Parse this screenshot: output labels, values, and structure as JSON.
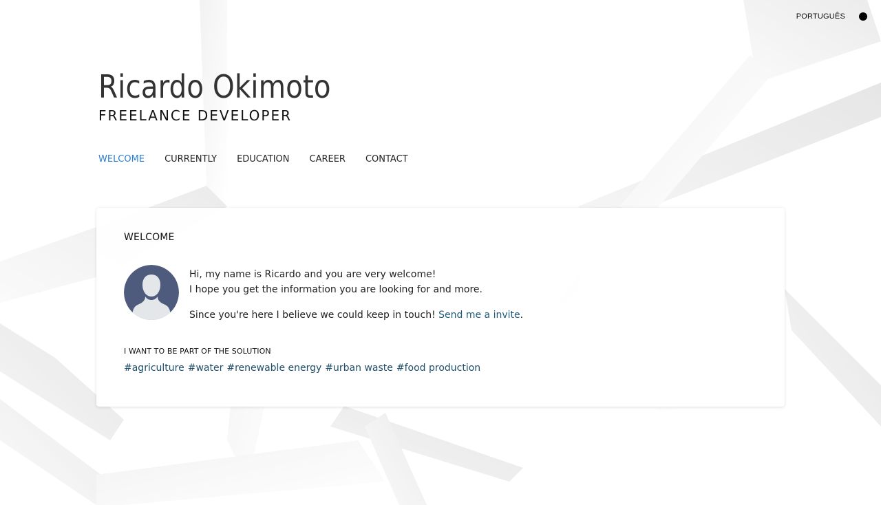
{
  "lang": {
    "label": "PORTUGUÊS"
  },
  "header": {
    "name": "Ricardo Okimoto",
    "role": "FREELANCE DEVELOPER"
  },
  "nav": {
    "items": [
      {
        "label": "WELCOME",
        "active": true
      },
      {
        "label": "CURRENTLY"
      },
      {
        "label": "EDUCATION"
      },
      {
        "label": "CAREER"
      },
      {
        "label": "CONTACT"
      }
    ]
  },
  "welcome": {
    "title": "WELCOME",
    "line1": "Hi, my name is Ricardo and you are very welcome!",
    "line2": "I hope you get the information you are looking for and more.",
    "line3_prefix": "Since you're here I believe we could keep in touch!",
    "invite_link": "Send me a invite",
    "line3_suffix": ".",
    "solution_title": "I WANT TO BE PART OF THE SOLUTION",
    "tags": [
      "#agriculture",
      "#water",
      "#renewable energy",
      "#urban waste",
      "#food production"
    ]
  },
  "colors": {
    "accent": "#2a7fd4",
    "link": "#1f5a7a",
    "avatar_bg": "#4f5b7d",
    "avatar_fg": "#e3e7ea"
  },
  "icons": {
    "avatar": "user-silhouette-icon",
    "lang_dot": "language-toggle-dot-icon"
  }
}
